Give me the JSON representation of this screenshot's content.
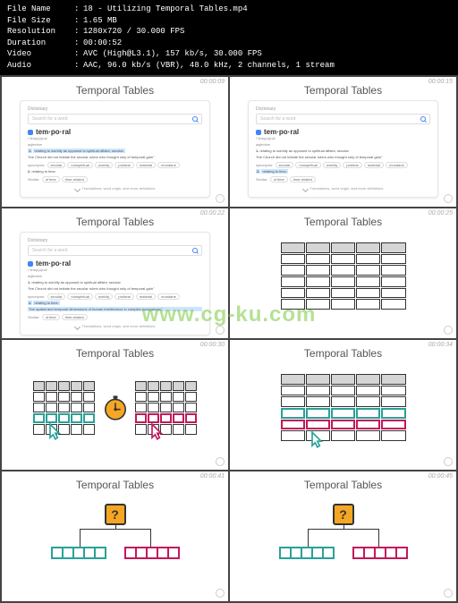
{
  "header": {
    "file_name_label": "File Name",
    "file_name": "18 - Utilizing Temporal Tables.mp4",
    "file_size_label": "File Size",
    "file_size": "1.65 MB",
    "resolution_label": "Resolution",
    "resolution": "1280x720 / 30.000 FPS",
    "duration_label": "Duration",
    "duration": "00:00:52",
    "video_label": "Video",
    "video": "AVC (High@L3.1), 157 kb/s, 30.000 FPS",
    "audio_label": "Audio",
    "audio": "AAC, 96.0 kb/s (VBR), 48.0 kHz, 2 channels, 1 stream"
  },
  "slide_title": "Temporal Tables",
  "timestamps": [
    "00:00:09",
    "00:00:15",
    "00:00:22",
    "00:00:25",
    "00:00:30",
    "00:00:34",
    "00:00:41",
    "00:00:45"
  ],
  "dict": {
    "label": "Dictionary",
    "search_placeholder": "Search for a word",
    "word": "tem·po·ral",
    "pronunciation": "/ˈtemp(ə)rəl/",
    "pos": "adjective",
    "def1_num": "1.",
    "def1_text": "relating to worldly as opposed to spiritual affairs; secular.",
    "def1_ex": "\"the Church did not imitate the secular rulers who thought only of temporal gain\"",
    "syn_label": "synonyms:",
    "synonyms": [
      "secular",
      "nonspiritual",
      "worldly",
      "profane",
      "material",
      "mundane"
    ],
    "def2_num": "2.",
    "def2_text": "relating to time.",
    "def2_ex": "\"the spatial and temporal dimensions of human interference in complex ecosystems\"",
    "similar_label": "Similar:",
    "similar": [
      "of time",
      "time-related"
    ],
    "more": "Translations, word origin, and more definitions"
  },
  "watermark": "www.cg-ku.com",
  "question_mark": "?"
}
